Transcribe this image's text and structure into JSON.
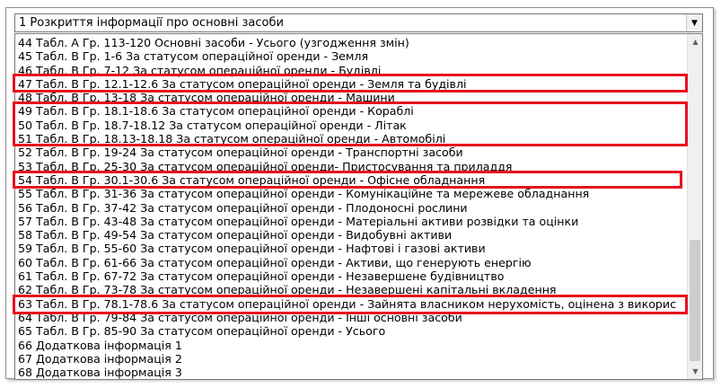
{
  "dropdown": {
    "selected": "1 Розкриття інформації про основні засоби",
    "arrow_icon": "chevron-down-icon"
  },
  "list": {
    "items": [
      "44 Табл. А Гр. 113-120 Основні засоби - Усього (узгодження змін)",
      "45 Табл. В Гр. 1-6  За статусом операційної оренди - Земля",
      "46 Табл. В Гр. 7-12  За статусом операційної оренди - Будівлі",
      "47 Табл. В Гр. 12.1-12.6  За статусом операційної оренди - Земля та будівлі",
      "48 Табл. В Гр. 13-18  За статусом операційної оренди - Машини",
      "49 Табл. В Гр. 18.1-18.6  За статусом операційної оренди - Кораблі",
      "50 Табл. В Гр. 18.7-18.12  За статусом операційної оренди - Літак",
      "51 Табл. В Гр. 18.13-18.18  За статусом операційної оренди - Автомобілі",
      "52 Табл. В Гр. 19-24  За статусом операційної оренди - Транспортні засоби",
      "53 Табл. В Гр. 25-30  За статусом операційної оренди- Пристосування та приладдя",
      "54 Табл. В Гр. 30.1-30.6  За статусом операційної оренди - Офісне обладнання",
      "55 Табл. В Гр. 31-36  За статусом операційної оренди - Комунікаційне та мережеве обладнання",
      "56 Табл. В Гр. 37-42  За статусом операційної оренди - Плодоносні рослини",
      "57 Табл. В Гр. 43-48  За статусом операційної оренди - Матеріальні активи розвідки та оцінки",
      "58 Табл. В Гр. 49-54  За статусом операційної оренди - Видобувні активи",
      "59 Табл. В Гр. 55-60  За статусом операційної оренди - Нафтові і газові активи",
      "60 Табл. В Гр. 61-66  За статусом операційної оренди - Активи, що генерують енергію",
      "61 Табл. В Гр. 67-72 За статусом операційної оренди - Незавершене будівництво",
      "62 Табл. В Гр. 73-78  За статусом операційної оренди - Незавершені капітальні вкладення",
      "63 Табл. В Гр. 78.1-78.6  За статусом операційної оренди - Зайнята власником нерухомість, оцінена з викорис",
      "64 Табл. В Гр. 79-84  За статусом операційної оренди - Інші основні засоби",
      "65 Табл. В Гр. 85-90  За статусом операційної оренди - Усього",
      "66 Додаткова інформація 1",
      "67 Додаткова інформація 2",
      "68 Додаткова інформація 3"
    ],
    "highlight_color": "#e8101e"
  },
  "scrollbar": {
    "up_icon": "scroll-up-arrow-icon",
    "down_icon": "scroll-down-arrow-icon"
  }
}
